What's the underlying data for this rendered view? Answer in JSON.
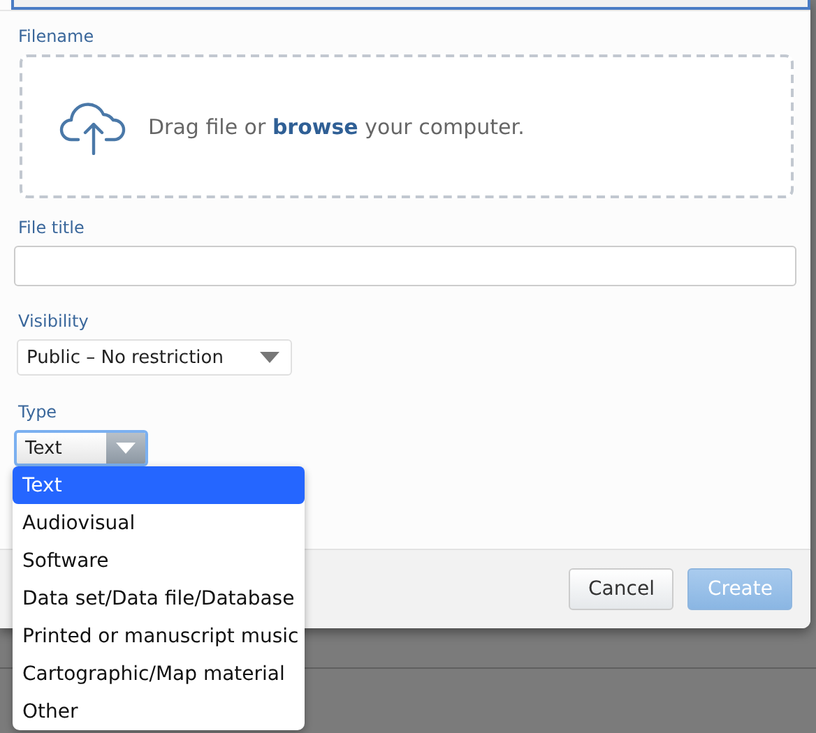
{
  "filename": {
    "label": "Filename",
    "drop_text": "Drag file or **browse** your computer."
  },
  "file_title": {
    "label": "File title"
  },
  "visibility": {
    "label": "Visibility",
    "value": "Public – No restriction"
  },
  "type": {
    "label": "Type",
    "value": "Text",
    "expanded": true,
    "options": [
      {
        "label": "Text",
        "selected": true
      },
      {
        "label": "Audiovisual",
        "selected": false
      },
      {
        "label": "Software",
        "selected": false
      },
      {
        "label": "Data set/Data file/Database",
        "selected": false
      },
      {
        "label": "Printed or manuscript music",
        "selected": false
      },
      {
        "label": "Cartographic/Map material",
        "selected": false
      },
      {
        "label": "Other",
        "selected": false
      }
    ]
  },
  "buttons": [
    {
      "label": "Cancel",
      "kind": "secondary",
      "disabled": false
    },
    {
      "label": "Create",
      "kind": "primary",
      "disabled": true
    }
  ]
}
